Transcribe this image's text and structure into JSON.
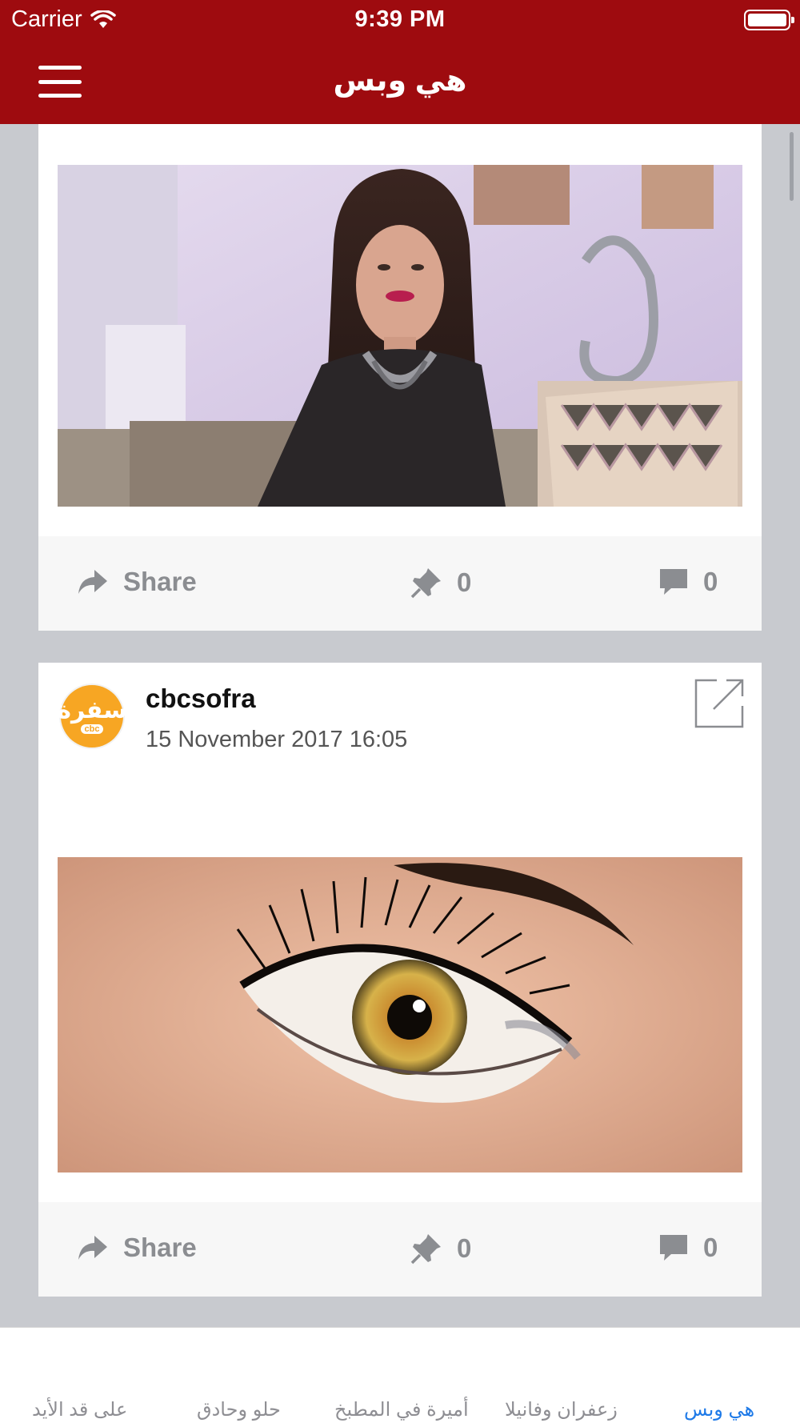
{
  "status_bar": {
    "carrier": "Carrier",
    "time": "9:39 PM"
  },
  "nav": {
    "title": "هي وبس"
  },
  "posts": [
    {
      "actions": {
        "share_label": "Share",
        "pin_count": "0",
        "comment_count": "0"
      }
    },
    {
      "username": "cbcsofra",
      "date": "15 November 2017 16:05",
      "logo_text": "سفرة",
      "logo_sub": "cbc",
      "actions": {
        "share_label": "Share",
        "pin_count": "0",
        "comment_count": "0"
      }
    }
  ],
  "tabs": [
    {
      "label": "هي وبس",
      "active": true
    },
    {
      "label": "زعفران وفانيلا",
      "active": false
    },
    {
      "label": "أميرة في المطبخ",
      "active": false
    },
    {
      "label": "حلو وحادق",
      "active": false
    },
    {
      "label": "على قد الأيد",
      "active": false
    }
  ],
  "colors": {
    "header": "#9e0b0f",
    "tab_active": "#1e7ae8",
    "logo": "#f7a623"
  }
}
